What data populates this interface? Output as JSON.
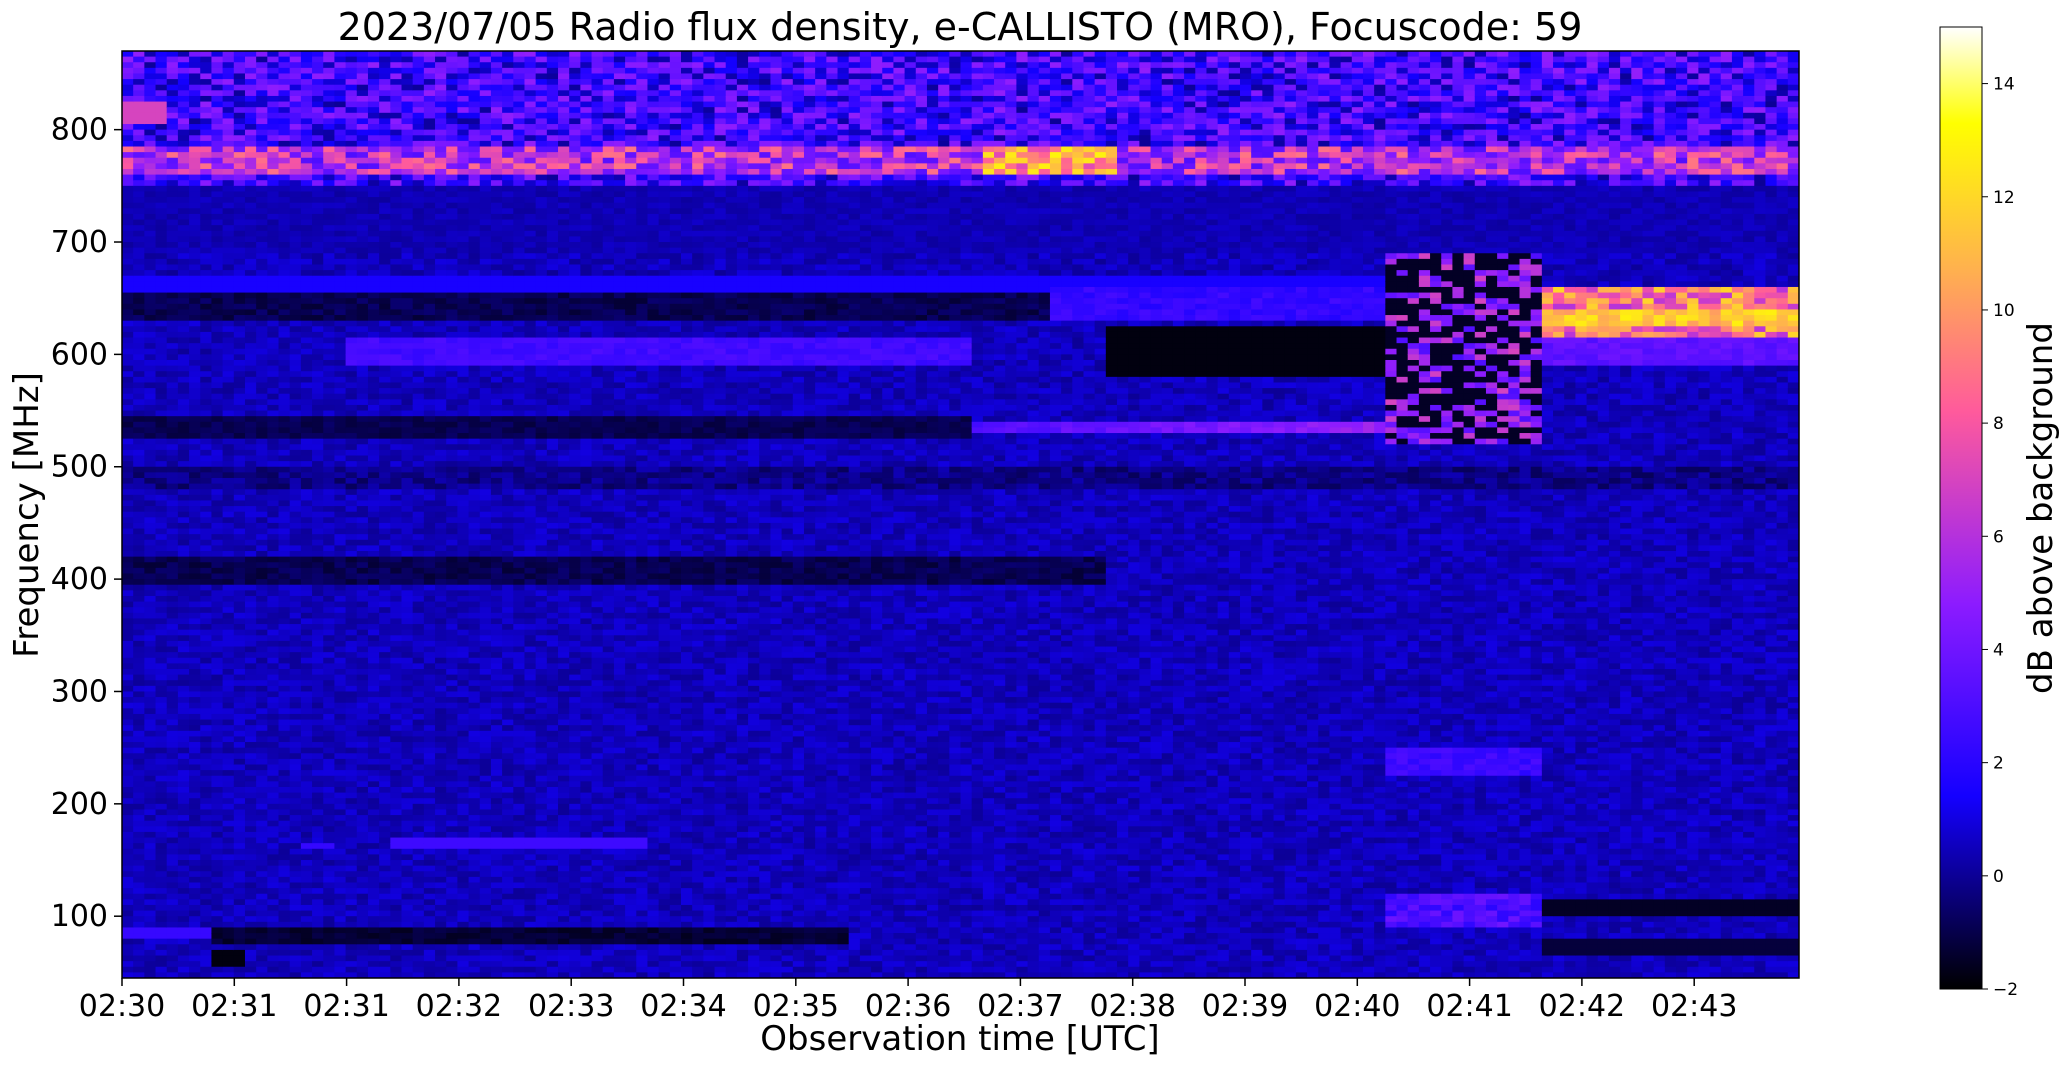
{
  "chart_data": {
    "type": "heatmap",
    "title": "2023/07/05  Radio flux density, e-CALLISTO (MRO), Focuscode: 59",
    "xlabel": "Observation time [UTC]",
    "ylabel": "Frequency [MHz]",
    "x_tick_labels": [
      "02:30",
      "02:31",
      "02:31",
      "02:32",
      "02:33",
      "02:34",
      "02:35",
      "02:36",
      "02:37",
      "02:38",
      "02:39",
      "02:40",
      "02:41",
      "02:42",
      "02:43"
    ],
    "y_ticks": [
      100,
      200,
      300,
      400,
      500,
      600,
      700,
      800
    ],
    "y_tick_labels": [
      "100",
      "200",
      "300",
      "400",
      "500",
      "600",
      "700",
      "800"
    ],
    "ylim": [
      45,
      870
    ],
    "colorbar": {
      "label": "dB above background",
      "ticks": [
        -2,
        0,
        2,
        4,
        6,
        8,
        10,
        12,
        14
      ],
      "tick_labels": [
        "−2",
        "0",
        "2",
        "4",
        "6",
        "8",
        "10",
        "12",
        "14"
      ],
      "range": [
        -2,
        15
      ],
      "colormap": "gnuplot2",
      "stops": [
        "#000000",
        "#1400ff",
        "#8c1bff",
        "#ff5a9c",
        "#ffb24d",
        "#ffff00",
        "#ffffff"
      ]
    },
    "background_level_db": 0.5,
    "bands": [
      {
        "freq": [
          750,
          840
        ],
        "db": 4.5,
        "desc": "strong interference band"
      },
      {
        "freq": [
          760,
          780
        ],
        "db": 9.5,
        "desc": "bright spikes with peak near 02:37"
      },
      {
        "freq": [
          640,
          660
        ],
        "db": -1.5,
        "desc": "dark band 02:30-02:41"
      },
      {
        "freq": [
          590,
          620
        ],
        "db": 2.5,
        "desc": "bright band 02:32-02:37"
      },
      {
        "freq": [
          590,
          620
        ],
        "db": -1.8,
        "desc": "dark band 02:38-02:41"
      },
      {
        "freq": [
          525,
          545
        ],
        "db": 4.5,
        "desc": "bright band 02:37-02:41"
      },
      {
        "freq": [
          480,
          500
        ],
        "db": -1.0,
        "desc": "dark striations"
      },
      {
        "freq": [
          395,
          420
        ],
        "db": -1.2,
        "desc": "dark band 02:30-02:38"
      },
      {
        "freq": [
          160,
          170
        ],
        "db": 2.5,
        "desc": "short bright line 02:32-02:34"
      },
      {
        "freq": [
          75,
          85
        ],
        "db": -1.5,
        "desc": "dark band 02:31-02:36"
      },
      {
        "freq": [
          615,
          660
        ],
        "db": 10.0,
        "desc": "bright band after 02:43"
      },
      {
        "freq": [
          520,
          680
        ],
        "db": 5.0,
        "desc": "burst 02:41-02:42"
      }
    ]
  }
}
